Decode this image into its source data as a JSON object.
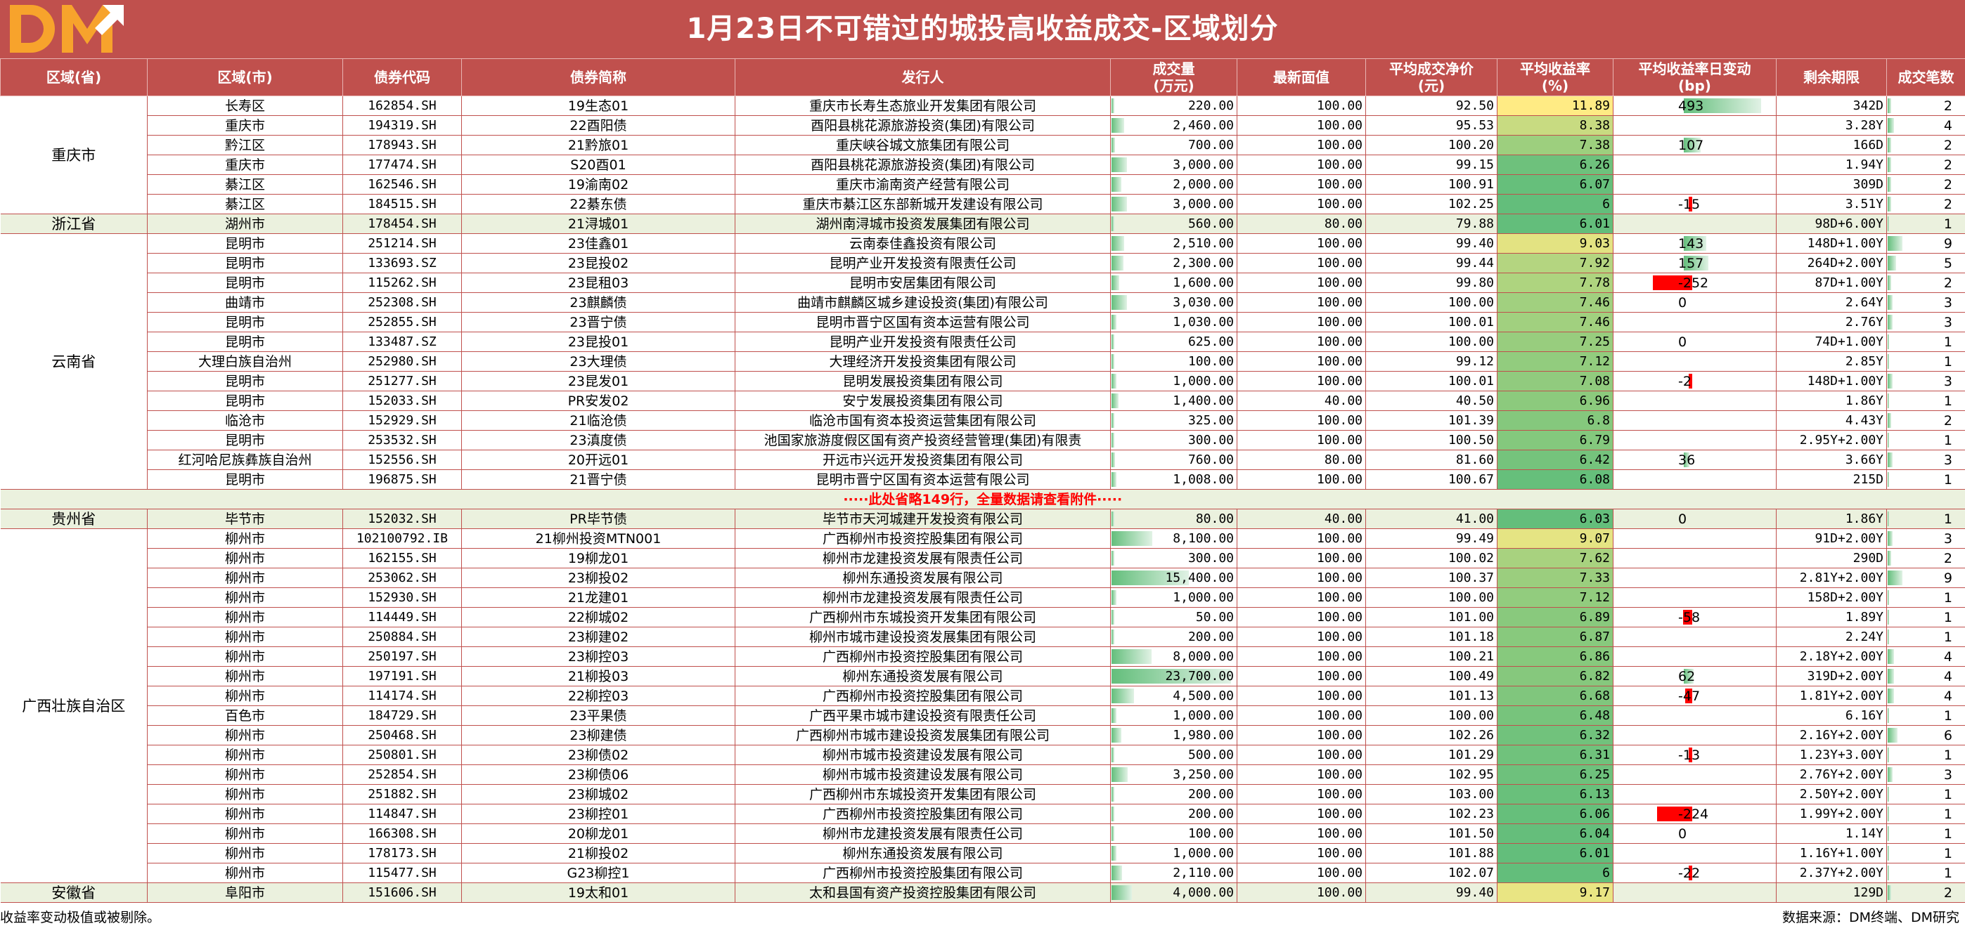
{
  "logo": {
    "text": "DM",
    "bg": "#c0504d"
  },
  "title": "1月23日不可错过的城投高收益成交-区域划分",
  "headers": [
    "区域(省)",
    "区域(市)",
    "债券代码",
    "债券简称",
    "发行人",
    "成交量\n(万元)",
    "最新面值",
    "平均成交净价\n(元)",
    "平均收益率\n(%)",
    "平均收益率日变动\n(bp)",
    "剩余期限",
    "成交笔数"
  ],
  "provinces": [
    {
      "name": "重庆市",
      "rows": 6
    },
    {
      "name": "浙江省",
      "rows": 1
    },
    {
      "name": "云南省",
      "rows": 13
    },
    {
      "name": "贵州省",
      "rows": 1
    },
    {
      "name": "广西壮族自治区",
      "rows": 18
    },
    {
      "name": "安徽省",
      "rows": 1
    }
  ],
  "rows": [
    {
      "city": "长寿区",
      "code": "162854.SH",
      "short": "19生态01",
      "issuer": "重庆市长寿生态旅业开发集团有限公司",
      "vol": "220.00",
      "face": "100.00",
      "price": "92.50",
      "yield": "11.89",
      "chg": "493",
      "term": "342D",
      "cnt": "2"
    },
    {
      "city": "重庆市",
      "code": "194319.SH",
      "short": "22酉阳债",
      "issuer": "酉阳县桃花源旅游投资(集团)有限公司",
      "vol": "2,460.00",
      "face": "100.00",
      "price": "95.53",
      "yield": "8.38",
      "chg": "",
      "term": "3.28Y",
      "cnt": "4"
    },
    {
      "city": "黔江区",
      "code": "178943.SH",
      "short": "21黔旅01",
      "issuer": "重庆峡谷城文旅集团有限公司",
      "vol": "700.00",
      "face": "100.00",
      "price": "100.20",
      "yield": "7.38",
      "chg": "107",
      "term": "166D",
      "cnt": "2"
    },
    {
      "city": "重庆市",
      "code": "177474.SH",
      "short": "S20酉01",
      "issuer": "酉阳县桃花源旅游投资(集团)有限公司",
      "vol": "3,000.00",
      "face": "100.00",
      "price": "99.15",
      "yield": "6.26",
      "chg": "",
      "term": "1.94Y",
      "cnt": "2"
    },
    {
      "city": "綦江区",
      "code": "162546.SH",
      "short": "19渝南02",
      "issuer": "重庆市渝南资产经营有限公司",
      "vol": "2,000.00",
      "face": "100.00",
      "price": "100.91",
      "yield": "6.07",
      "chg": "",
      "term": "309D",
      "cnt": "2"
    },
    {
      "city": "綦江区",
      "code": "184515.SH",
      "short": "22綦东债",
      "issuer": "重庆市綦江区东部新城开发建设有限公司",
      "vol": "3,000.00",
      "face": "100.00",
      "price": "102.25",
      "yield": "6",
      "chg": "-15",
      "term": "3.51Y",
      "cnt": "2"
    },
    {
      "city": "湖州市",
      "code": "178454.SH",
      "short": "21浔城01",
      "issuer": "湖州南浔城市投资发展集团有限公司",
      "vol": "560.00",
      "face": "80.00",
      "price": "79.88",
      "yield": "6.01",
      "chg": "",
      "term": "98D+6.00Y",
      "cnt": "1"
    },
    {
      "city": "昆明市",
      "code": "251214.SH",
      "short": "23佳鑫01",
      "issuer": "云南泰佳鑫投资有限公司",
      "vol": "2,510.00",
      "face": "100.00",
      "price": "99.40",
      "yield": "9.03",
      "chg": "143",
      "term": "148D+1.00Y",
      "cnt": "9"
    },
    {
      "city": "昆明市",
      "code": "133693.SZ",
      "short": "23昆投02",
      "issuer": "昆明产业开发投资有限责任公司",
      "vol": "2,300.00",
      "face": "100.00",
      "price": "99.44",
      "yield": "7.92",
      "chg": "157",
      "term": "264D+2.00Y",
      "cnt": "5"
    },
    {
      "city": "昆明市",
      "code": "115262.SH",
      "short": "23昆租03",
      "issuer": "昆明市安居集团有限公司",
      "vol": "1,600.00",
      "face": "100.00",
      "price": "99.80",
      "yield": "7.78",
      "chg": "-252",
      "term": "87D+1.00Y",
      "cnt": "2"
    },
    {
      "city": "曲靖市",
      "code": "252308.SH",
      "short": "23麒麟债",
      "issuer": "曲靖市麒麟区城乡建设投资(集团)有限公司",
      "vol": "3,030.00",
      "face": "100.00",
      "price": "100.00",
      "yield": "7.46",
      "chg": "0",
      "term": "2.64Y",
      "cnt": "3"
    },
    {
      "city": "昆明市",
      "code": "252855.SH",
      "short": "23晋宁债",
      "issuer": "昆明市晋宁区国有资本运营有限公司",
      "vol": "1,030.00",
      "face": "100.00",
      "price": "100.01",
      "yield": "7.46",
      "chg": "",
      "term": "2.76Y",
      "cnt": "3"
    },
    {
      "city": "昆明市",
      "code": "133487.SZ",
      "short": "23昆投01",
      "issuer": "昆明产业开发投资有限责任公司",
      "vol": "625.00",
      "face": "100.00",
      "price": "100.00",
      "yield": "7.25",
      "chg": "0",
      "term": "74D+1.00Y",
      "cnt": "1"
    },
    {
      "city": "大理白族自治州",
      "code": "252980.SH",
      "short": "23大理债",
      "issuer": "大理经济开发投资集团有限公司",
      "vol": "100.00",
      "face": "100.00",
      "price": "99.12",
      "yield": "7.12",
      "chg": "",
      "term": "2.85Y",
      "cnt": "1"
    },
    {
      "city": "昆明市",
      "code": "251277.SH",
      "short": "23昆发01",
      "issuer": "昆明发展投资集团有限公司",
      "vol": "1,000.00",
      "face": "100.00",
      "price": "100.01",
      "yield": "7.08",
      "chg": "-2",
      "term": "148D+1.00Y",
      "cnt": "3"
    },
    {
      "city": "昆明市",
      "code": "152033.SH",
      "short": "PR安发02",
      "issuer": "安宁发展投资集团有限公司",
      "vol": "1,400.00",
      "face": "40.00",
      "price": "40.50",
      "yield": "6.96",
      "chg": "",
      "term": "1.86Y",
      "cnt": "1"
    },
    {
      "city": "临沧市",
      "code": "152929.SH",
      "short": "21临沧债",
      "issuer": "临沧市国有资本投资运营集团有限公司",
      "vol": "325.00",
      "face": "100.00",
      "price": "101.39",
      "yield": "6.8",
      "chg": "",
      "term": "4.43Y",
      "cnt": "2"
    },
    {
      "city": "昆明市",
      "code": "253532.SH",
      "short": "23滇度债",
      "issuer": "池国家旅游度假区国有资产投资经营管理(集团)有限责",
      "vol": "300.00",
      "face": "100.00",
      "price": "100.50",
      "yield": "6.79",
      "chg": "",
      "term": "2.95Y+2.00Y",
      "cnt": "1"
    },
    {
      "city": "红河哈尼族彝族自治州",
      "code": "152556.SH",
      "short": "20开远01",
      "issuer": "开远市兴远开发投资集团有限公司",
      "vol": "760.00",
      "face": "80.00",
      "price": "81.60",
      "yield": "6.42",
      "chg": "36",
      "term": "3.66Y",
      "cnt": "3"
    },
    {
      "city": "昆明市",
      "code": "196875.SH",
      "short": "21晋宁债",
      "issuer": "昆明市晋宁区国有资本运营有限公司",
      "vol": "1,008.00",
      "face": "100.00",
      "price": "100.67",
      "yield": "6.08",
      "chg": "",
      "term": "215D",
      "cnt": "1"
    },
    {
      "city": "毕节市",
      "code": "152032.SH",
      "short": "PR毕节债",
      "issuer": "毕节市天河城建开发投资有限公司",
      "vol": "80.00",
      "face": "40.00",
      "price": "41.00",
      "yield": "6.03",
      "chg": "0",
      "term": "1.86Y",
      "cnt": "1"
    },
    {
      "city": "柳州市",
      "code": "102100792.IB",
      "short": "21柳州投资MTN001",
      "issuer": "广西柳州市投资控股集团有限公司",
      "vol": "8,100.00",
      "face": "100.00",
      "price": "99.49",
      "yield": "9.07",
      "chg": "",
      "term": "91D+2.00Y",
      "cnt": "3"
    },
    {
      "city": "柳州市",
      "code": "162155.SH",
      "short": "19柳龙01",
      "issuer": "柳州市龙建投资发展有限责任公司",
      "vol": "300.00",
      "face": "100.00",
      "price": "100.02",
      "yield": "7.62",
      "chg": "",
      "term": "290D",
      "cnt": "2"
    },
    {
      "city": "柳州市",
      "code": "253062.SH",
      "short": "23柳投02",
      "issuer": "柳州东通投资发展有限公司",
      "vol": "15,400.00",
      "face": "100.00",
      "price": "100.37",
      "yield": "7.33",
      "chg": "",
      "term": "2.81Y+2.00Y",
      "cnt": "9"
    },
    {
      "city": "柳州市",
      "code": "152930.SH",
      "short": "21龙建01",
      "issuer": "柳州市龙建投资发展有限责任公司",
      "vol": "1,000.00",
      "face": "100.00",
      "price": "100.00",
      "yield": "7.12",
      "chg": "",
      "term": "158D+2.00Y",
      "cnt": "1"
    },
    {
      "city": "柳州市",
      "code": "114449.SH",
      "short": "22柳城02",
      "issuer": "广西柳州市东城投资开发集团有限公司",
      "vol": "50.00",
      "face": "100.00",
      "price": "101.00",
      "yield": "6.89",
      "chg": "-58",
      "term": "1.89Y",
      "cnt": "1"
    },
    {
      "city": "柳州市",
      "code": "250884.SH",
      "short": "23柳建02",
      "issuer": "柳州市城市建设投资发展集团有限公司",
      "vol": "200.00",
      "face": "100.00",
      "price": "101.18",
      "yield": "6.87",
      "chg": "",
      "term": "2.24Y",
      "cnt": "1"
    },
    {
      "city": "柳州市",
      "code": "250197.SH",
      "short": "23柳控03",
      "issuer": "广西柳州市投资控股集团有限公司",
      "vol": "8,000.00",
      "face": "100.00",
      "price": "100.21",
      "yield": "6.86",
      "chg": "",
      "term": "2.18Y+2.00Y",
      "cnt": "4"
    },
    {
      "city": "柳州市",
      "code": "197191.SH",
      "short": "21柳投03",
      "issuer": "柳州东通投资发展有限公司",
      "vol": "23,700.00",
      "face": "100.00",
      "price": "100.49",
      "yield": "6.82",
      "chg": "62",
      "term": "319D+2.00Y",
      "cnt": "4"
    },
    {
      "city": "柳州市",
      "code": "114174.SH",
      "short": "22柳控03",
      "issuer": "广西柳州市投资控股集团有限公司",
      "vol": "4,500.00",
      "face": "100.00",
      "price": "101.13",
      "yield": "6.68",
      "chg": "-47",
      "term": "1.81Y+2.00Y",
      "cnt": "4"
    },
    {
      "city": "百色市",
      "code": "184729.SH",
      "short": "23平果债",
      "issuer": "广西平果市城市建设投资有限责任公司",
      "vol": "1,000.00",
      "face": "100.00",
      "price": "100.00",
      "yield": "6.48",
      "chg": "",
      "term": "6.16Y",
      "cnt": "1"
    },
    {
      "city": "柳州市",
      "code": "250468.SH",
      "short": "23柳建债",
      "issuer": "广西柳州市城市建设投资发展集团有限公司",
      "vol": "1,980.00",
      "face": "100.00",
      "price": "102.26",
      "yield": "6.32",
      "chg": "",
      "term": "2.16Y+2.00Y",
      "cnt": "6"
    },
    {
      "city": "柳州市",
      "code": "250801.SH",
      "short": "23柳债02",
      "issuer": "柳州市城市投资建设发展有限公司",
      "vol": "500.00",
      "face": "100.00",
      "price": "101.29",
      "yield": "6.31",
      "chg": "-13",
      "term": "1.23Y+3.00Y",
      "cnt": "1"
    },
    {
      "city": "柳州市",
      "code": "252854.SH",
      "short": "23柳债06",
      "issuer": "柳州市城市投资建设发展有限公司",
      "vol": "3,250.00",
      "face": "100.00",
      "price": "102.95",
      "yield": "6.25",
      "chg": "",
      "term": "2.76Y+2.00Y",
      "cnt": "3"
    },
    {
      "city": "柳州市",
      "code": "251882.SH",
      "short": "23柳城02",
      "issuer": "广西柳州市东城投资开发集团有限公司",
      "vol": "200.00",
      "face": "100.00",
      "price": "103.00",
      "yield": "6.13",
      "chg": "",
      "term": "2.50Y+2.00Y",
      "cnt": "1"
    },
    {
      "city": "柳州市",
      "code": "114847.SH",
      "short": "23柳控01",
      "issuer": "广西柳州市投资控股集团有限公司",
      "vol": "200.00",
      "face": "100.00",
      "price": "102.23",
      "yield": "6.06",
      "chg": "-224",
      "term": "1.99Y+2.00Y",
      "cnt": "1"
    },
    {
      "city": "柳州市",
      "code": "166308.SH",
      "short": "20柳龙01",
      "issuer": "柳州市龙建投资发展有限责任公司",
      "vol": "100.00",
      "face": "100.00",
      "price": "101.50",
      "yield": "6.04",
      "chg": "0",
      "term": "1.14Y",
      "cnt": "1"
    },
    {
      "city": "柳州市",
      "code": "178173.SH",
      "short": "21柳投02",
      "issuer": "柳州东通投资发展有限公司",
      "vol": "1,000.00",
      "face": "100.00",
      "price": "101.88",
      "yield": "6.01",
      "chg": "",
      "term": "1.16Y+1.00Y",
      "cnt": "1"
    },
    {
      "city": "柳州市",
      "code": "115477.SH",
      "short": "G23柳控1",
      "issuer": "广西柳州市投资控股集团有限公司",
      "vol": "2,110.00",
      "face": "100.00",
      "price": "102.07",
      "yield": "6",
      "chg": "-22",
      "term": "2.37Y+2.00Y",
      "cnt": "1"
    },
    {
      "city": "阜阳市",
      "code": "151606.SH",
      "short": "19太和01",
      "issuer": "太和县国有资产投资控股集团有限公司",
      "vol": "4,000.00",
      "face": "100.00",
      "price": "99.40",
      "yield": "9.17",
      "chg": "",
      "term": "129D",
      "cnt": "2"
    }
  ],
  "omit_text": "·····此处省略149行，全量数据请查看附件·····",
  "footer_left": "收益率变动极值或被剔除。",
  "footer_right": "数据来源：DM终端、DM研究",
  "colors": {
    "header": "#c0504d",
    "good": "#63be7b",
    "mid": "#ffeb84",
    "neg": "#ff0000",
    "band": "#ebf1de"
  }
}
